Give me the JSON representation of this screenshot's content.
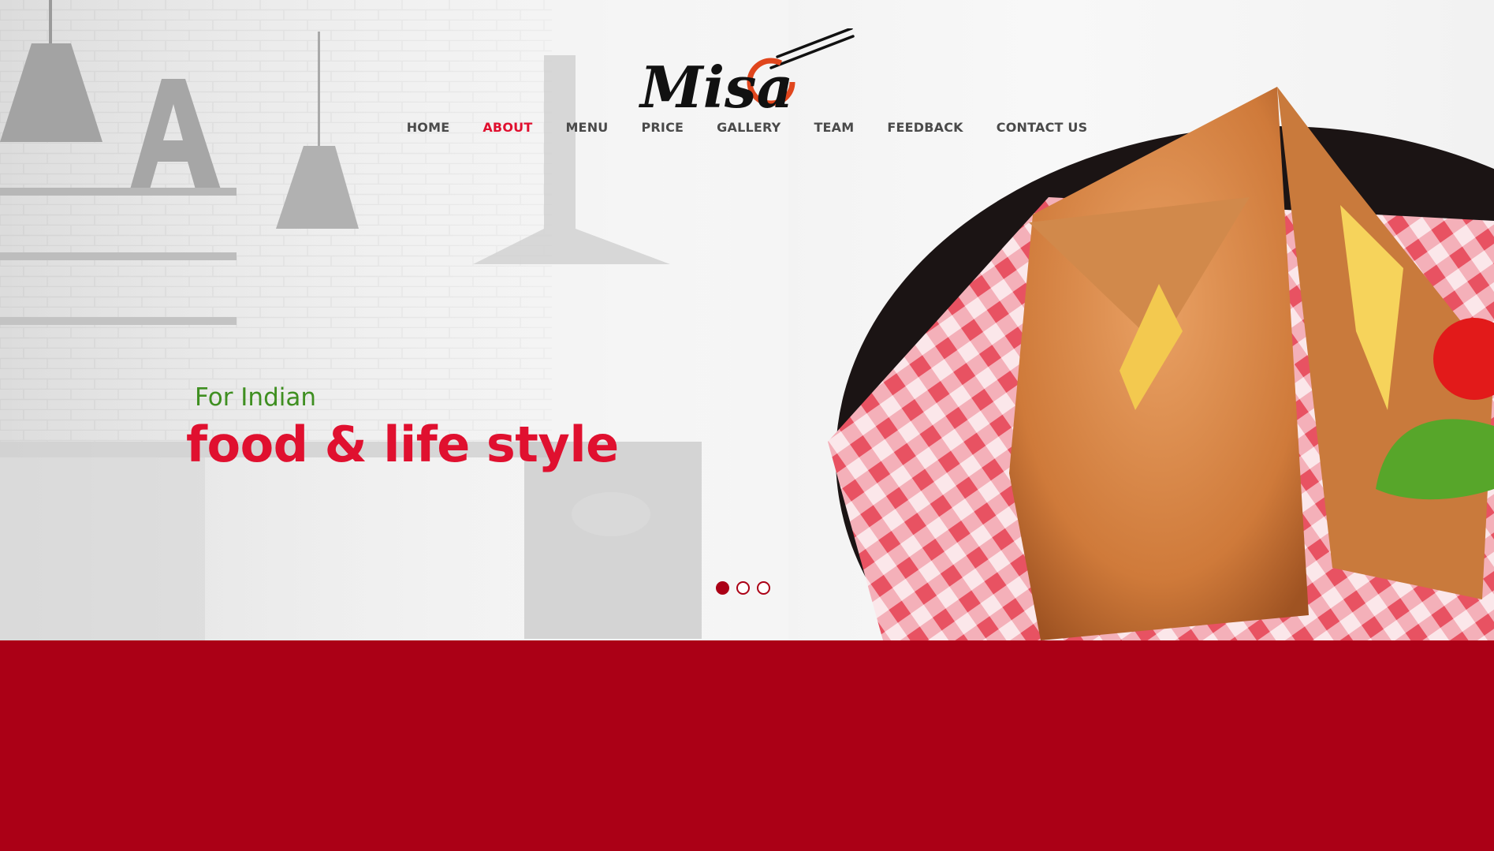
{
  "brand": {
    "logo_text": "Misa",
    "accent_color": "#e0102f",
    "band_color": "#ab0016"
  },
  "nav": {
    "items": [
      {
        "label": "HOME"
      },
      {
        "label": "ABOUT"
      },
      {
        "label": "MENU"
      },
      {
        "label": "PRICE"
      },
      {
        "label": "GALLERY"
      },
      {
        "label": "TEAM"
      },
      {
        "label": "FEEDBACK"
      },
      {
        "label": "CONTACT US"
      }
    ],
    "active": "ABOUT"
  },
  "hero": {
    "subtitle": "For Indian",
    "title": "food & life style",
    "slides_total": 3,
    "active_slide": 1
  }
}
